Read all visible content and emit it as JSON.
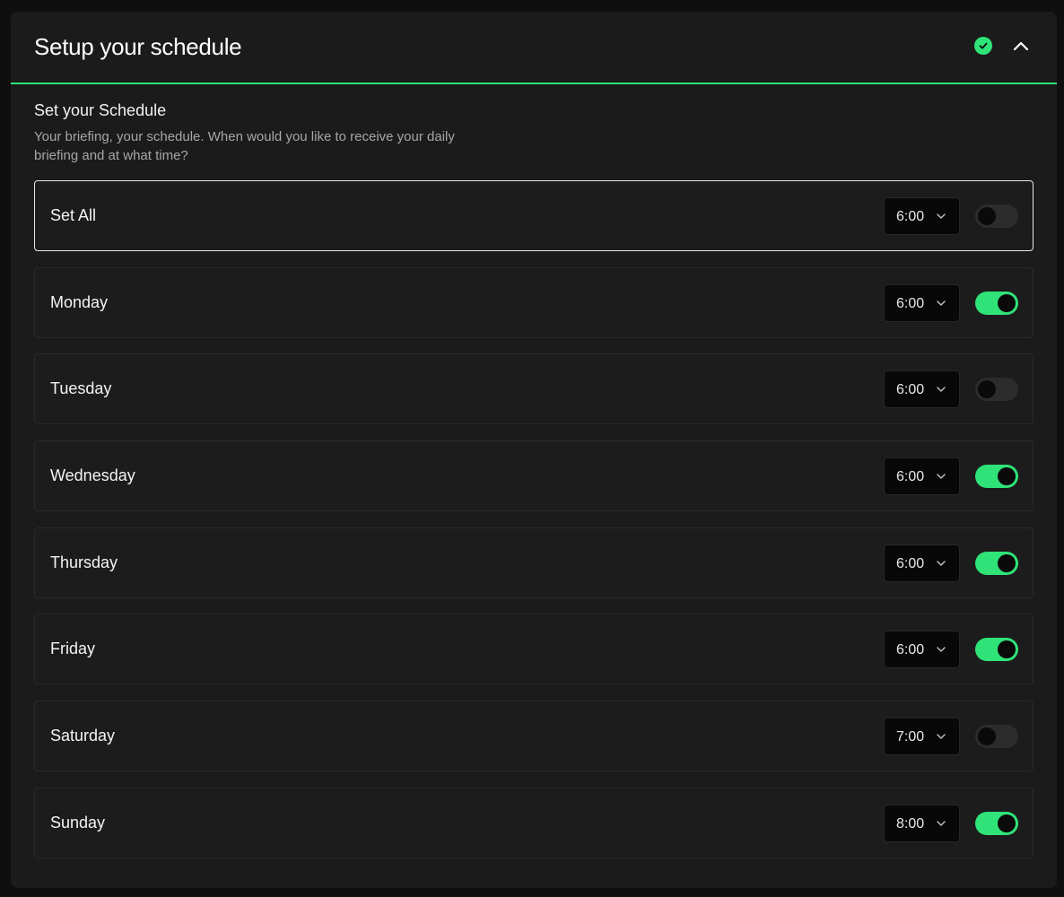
{
  "header": {
    "title": "Setup your schedule",
    "status_icon": "check-circle-icon",
    "collapse_icon": "chevron-up-icon"
  },
  "section": {
    "title": "Set your Schedule",
    "description": "Your briefing, your schedule. When would you like to receive your daily briefing and at what time?"
  },
  "colors": {
    "accent": "#2fe378",
    "card_background": "#1b1b1b",
    "select_background": "#080808"
  },
  "rows": [
    {
      "label": "Set All",
      "time": "6:00",
      "enabled": false
    },
    {
      "label": "Monday",
      "time": "6:00",
      "enabled": true
    },
    {
      "label": "Tuesday",
      "time": "6:00",
      "enabled": false
    },
    {
      "label": "Wednesday",
      "time": "6:00",
      "enabled": true
    },
    {
      "label": "Thursday",
      "time": "6:00",
      "enabled": true
    },
    {
      "label": "Friday",
      "time": "6:00",
      "enabled": true
    },
    {
      "label": "Saturday",
      "time": "7:00",
      "enabled": false
    },
    {
      "label": "Sunday",
      "time": "8:00",
      "enabled": true
    }
  ]
}
